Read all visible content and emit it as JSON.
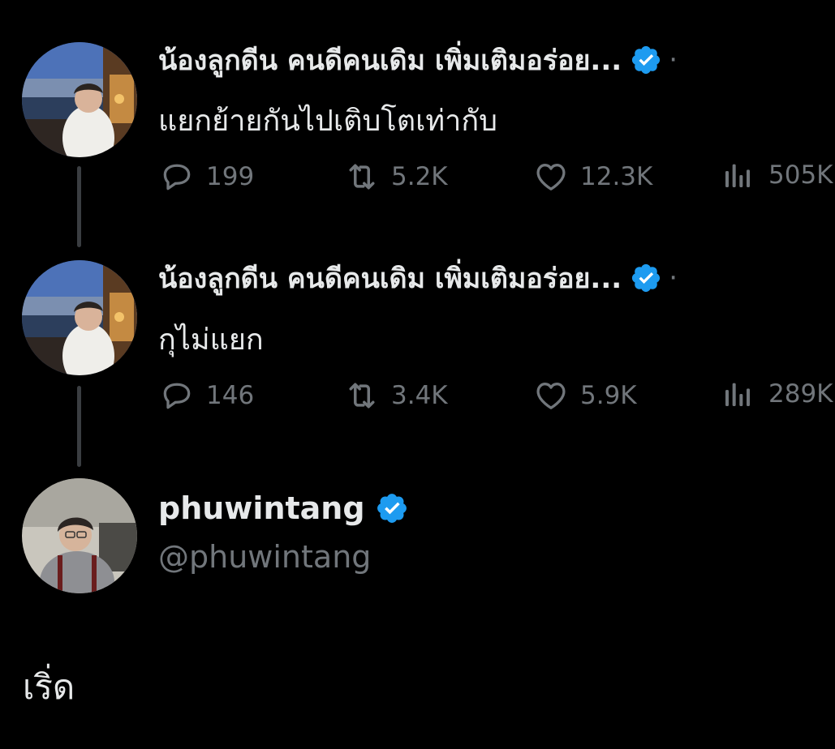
{
  "colors": {
    "background": "#000000",
    "text": "#e7e9ea",
    "muted": "#71767b",
    "verified": "#1d9bf0",
    "thread_line": "#3a3d41"
  },
  "replies": [
    {
      "author_name": "น้องลูกดีน คนดีคนเดิม เพิ่มเติมอร่อย...",
      "separator": "·",
      "text": "แยกย้ายกันไปเติบโตเท่ากับ",
      "metrics": {
        "replies": "199",
        "reposts": "5.2K",
        "likes": "12.3K",
        "views": "505K"
      }
    },
    {
      "author_name": "น้องลูกดีน คนดีคนเดิม เพิ่มเติมอร่อย...",
      "separator": "·",
      "text": "กุไม่แยก",
      "metrics": {
        "replies": "146",
        "reposts": "3.4K",
        "likes": "5.9K",
        "views": "289K"
      }
    }
  ],
  "main_tweet": {
    "display_name": "phuwintang",
    "handle": "@phuwintang",
    "text": "เริ่ด"
  },
  "icons": {
    "reply": "speech-bubble-icon",
    "repost": "repost-arrows-icon",
    "like": "heart-icon",
    "views": "bar-chart-icon",
    "verified": "verified-badge-icon"
  }
}
